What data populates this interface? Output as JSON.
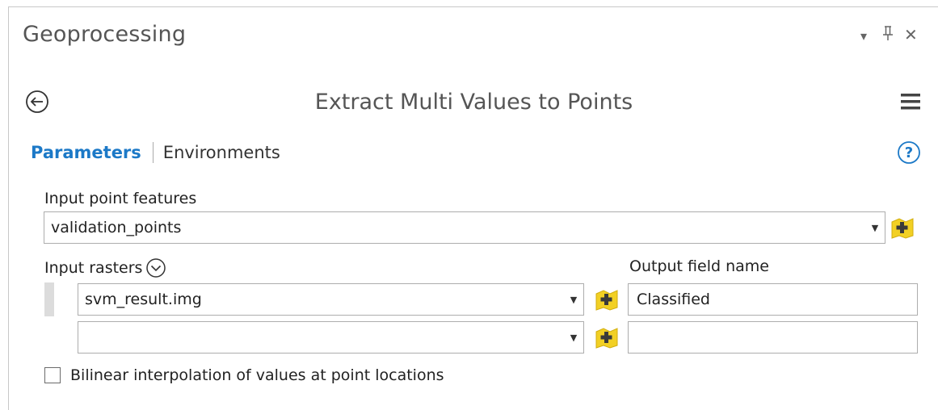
{
  "pane": {
    "title": "Geoprocessing",
    "controls": {
      "dropdown": "▾",
      "pin": "ᛘ",
      "close": "✕"
    }
  },
  "tool": {
    "title": "Extract Multi Values to Points"
  },
  "tabs": {
    "parameters": "Parameters",
    "environments": "Environments"
  },
  "params": {
    "input_point_features_label": "Input point features",
    "input_point_features_value": "validation_points",
    "input_rasters_label": "Input rasters",
    "output_field_name_label": "Output field name",
    "rasters": [
      {
        "raster": "svm_result.img",
        "field": "Classified"
      },
      {
        "raster": "",
        "field": ""
      }
    ],
    "bilinear_label": "Bilinear interpolation of values at point locations",
    "bilinear_checked": false
  },
  "colors": {
    "accent": "#1c79c7",
    "add_icon_yellow": "#f2d024"
  }
}
